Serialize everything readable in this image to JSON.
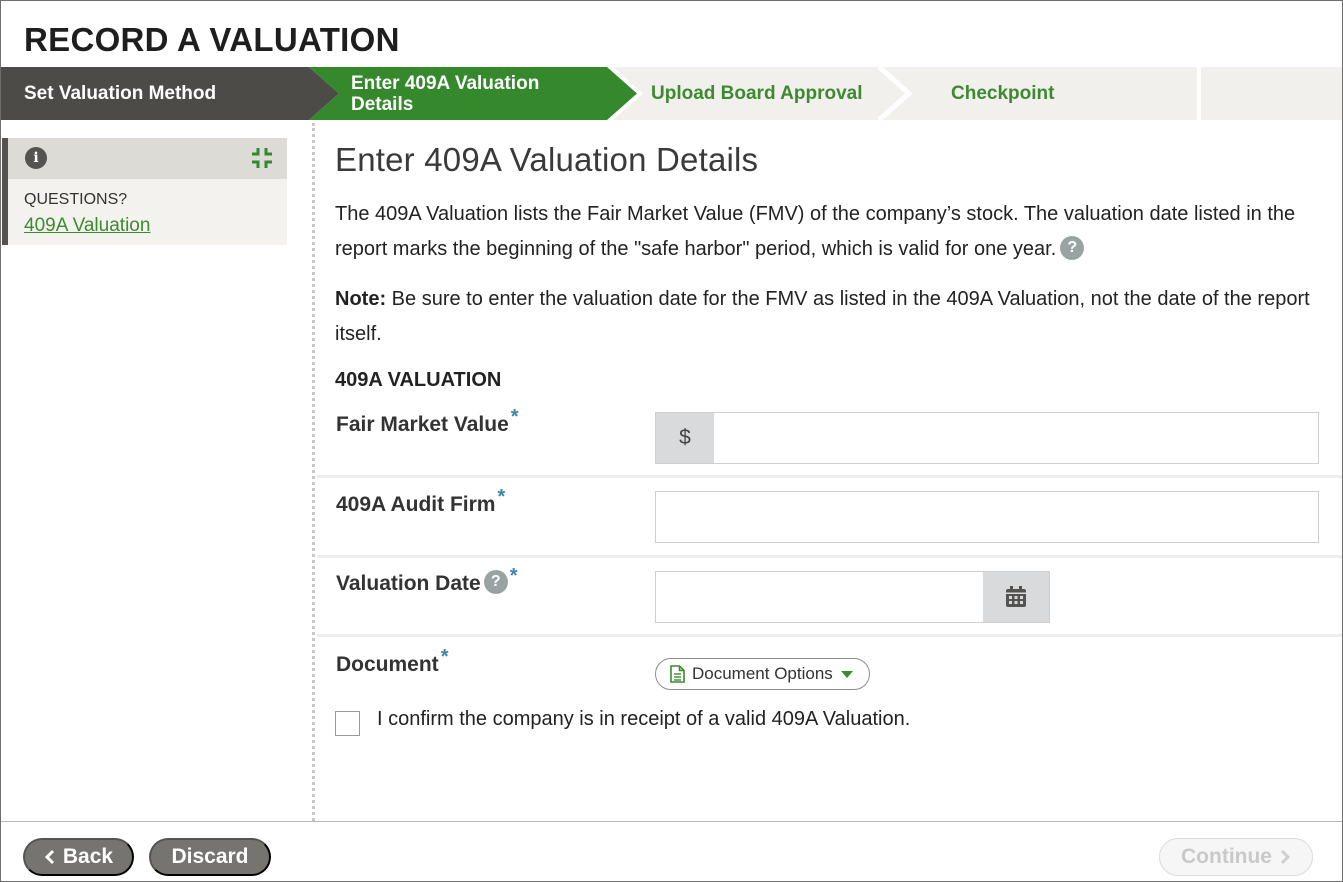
{
  "page": {
    "title": "RECORD A VALUATION"
  },
  "stepper": {
    "steps": [
      {
        "label": "Set Valuation Method",
        "state": "complete"
      },
      {
        "label": "Enter 409A Valuation Details",
        "state": "active"
      },
      {
        "label": "Upload Board Approval",
        "state": "pending"
      },
      {
        "label": "Checkpoint",
        "state": "pending"
      }
    ]
  },
  "help": {
    "info_icon": "info-icon",
    "collapse_icon": "collapse-icon",
    "question_label": "QUESTIONS?",
    "link_label": "409A Valuation"
  },
  "main": {
    "title": "Enter 409A Valuation Details",
    "intro": "The 409A Valuation lists the Fair Market Value (FMV) of the company’s stock. The valuation date listed in the report marks the beginning of the \"safe harbor\" period, which is valid for one year.",
    "note_label": "Note:",
    "note_text": "Be sure to enter the valuation date for the FMV as listed in the 409A Valuation, not the date of the report itself.",
    "section_heading": "409A VALUATION",
    "help_glyph": "?"
  },
  "form": {
    "required_mark": "*",
    "fair_market_value": {
      "label": "Fair Market Value",
      "prefix": "$",
      "value": "",
      "placeholder": ""
    },
    "audit_firm": {
      "label": "409A Audit Firm",
      "value": "",
      "placeholder": ""
    },
    "valuation_date": {
      "label": "Valuation Date",
      "value": "",
      "placeholder": ""
    },
    "document": {
      "label": "Document",
      "options_label": "Document Options"
    },
    "confirm": {
      "label": "I confirm the company is in receipt of a valid 409A Valuation.",
      "checked": false
    }
  },
  "footer": {
    "back_label": "Back",
    "discard_label": "Discard",
    "continue_label": "Continue"
  },
  "colors": {
    "brand_green": "#35892c",
    "dark_step": "#4d4b48",
    "button_gray": "#767471",
    "required_blue": "#3a86a6"
  }
}
